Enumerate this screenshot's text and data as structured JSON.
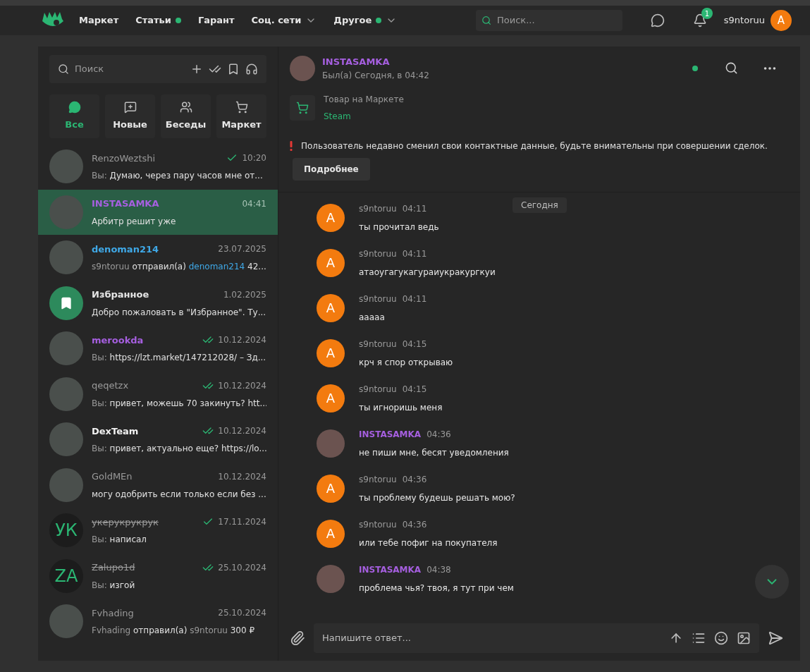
{
  "nav": {
    "items": [
      {
        "label": "Маркет",
        "dot": false,
        "dropdown": false
      },
      {
        "label": "Статьи",
        "dot": true,
        "dropdown": false
      },
      {
        "label": "Гарант",
        "dot": false,
        "dropdown": false
      },
      {
        "label": "Соц. сети",
        "dot": false,
        "dropdown": true
      },
      {
        "label": "Другое",
        "dot": true,
        "dropdown": true
      }
    ],
    "search": {
      "placeholder": "Поиск..."
    },
    "notifications": "1",
    "username": "s9ntoruu",
    "avatar_letter": "A"
  },
  "sidebar": {
    "search": {
      "placeholder": "Поиск"
    },
    "filters": [
      {
        "label": "Все",
        "selected": true,
        "kind": "all"
      },
      {
        "label": "Новые",
        "selected": false,
        "kind": "new"
      },
      {
        "label": "Беседы",
        "selected": false,
        "kind": "groups"
      },
      {
        "label": "Маркет",
        "selected": false,
        "kind": "market"
      }
    ],
    "chats": [
      {
        "name": "RenzoWeztshi",
        "color": "#9a9a9a",
        "bold": false,
        "struck": false,
        "time": "10:20",
        "sent": true,
        "read": false,
        "selected": false,
        "avatar": {
          "kind": "photo"
        },
        "preview": [
          {
            "text": "Вы:",
            "kind": "muted"
          },
          {
            "text": "Думаю, через пару часов мне от...",
            "kind": "normal"
          }
        ]
      },
      {
        "name": "INSTASAMKA",
        "color": "#a65fe0",
        "bold": true,
        "struck": false,
        "time": "04:41",
        "sent": false,
        "selected": true,
        "avatar": {
          "kind": "photo"
        },
        "preview": [
          {
            "text": "Арбитр решит уже",
            "kind": "normal"
          }
        ]
      },
      {
        "name": "denoman214",
        "color": "#3fa9e8",
        "bold": true,
        "struck": false,
        "time": "23.07.2025",
        "sent": false,
        "selected": false,
        "avatar": {
          "kind": "photo"
        },
        "preview": [
          {
            "text": "s9ntoruu",
            "kind": "muted"
          },
          {
            "text": "отправил(а)",
            "kind": "normal"
          },
          {
            "text": "denoman214",
            "kind": "link"
          },
          {
            "text": "42...",
            "kind": "normal"
          }
        ]
      },
      {
        "name": "Избранное",
        "color": "#e6e6e6",
        "bold": true,
        "struck": false,
        "time": "1.02.2025",
        "sent": false,
        "selected": false,
        "avatar": {
          "kind": "bookmark"
        },
        "preview": [
          {
            "text": "Добро пожаловать в \"Избранное\". Ту...",
            "kind": "normal"
          }
        ]
      },
      {
        "name": "merookda",
        "color": "#a65fe0",
        "bold": true,
        "struck": false,
        "time": "10.12.2024",
        "sent": true,
        "read": true,
        "selected": false,
        "avatar": {
          "kind": "photo"
        },
        "preview": [
          {
            "text": "Вы:",
            "kind": "muted"
          },
          {
            "text": "https://lzt.market/147212028/ – Зд...",
            "kind": "normal"
          }
        ]
      },
      {
        "name": "qeqetzx",
        "color": "#9a9a9a",
        "bold": false,
        "struck": false,
        "time": "10.12.2024",
        "sent": true,
        "read": true,
        "selected": false,
        "avatar": {
          "kind": "photo"
        },
        "preview": [
          {
            "text": "Вы:",
            "kind": "muted"
          },
          {
            "text": "привет, можешь 70 закинуть? htt...",
            "kind": "normal"
          }
        ]
      },
      {
        "name": "DexTeam",
        "color": "#f2f2f2",
        "bold": true,
        "struck": false,
        "time": "10.12.2024",
        "sent": true,
        "read": true,
        "selected": false,
        "avatar": {
          "kind": "photo"
        },
        "preview": [
          {
            "text": "Вы:",
            "kind": "muted"
          },
          {
            "text": "привет, актуально еще? https://lo...",
            "kind": "normal"
          }
        ]
      },
      {
        "name": "GoldMEn",
        "color": "#9a9a9a",
        "bold": false,
        "struck": false,
        "time": "10.12.2024",
        "sent": false,
        "selected": false,
        "avatar": {
          "kind": "photo"
        },
        "preview": [
          {
            "text": "могу одобрить если только если без ...",
            "kind": "normal"
          }
        ]
      },
      {
        "name": "укерукрукрук",
        "color": "#9a9a9a",
        "bold": false,
        "struck": true,
        "time": "17.11.2024",
        "sent": true,
        "read": false,
        "selected": false,
        "avatar": {
          "kind": "initials",
          "text": "УК"
        },
        "preview": [
          {
            "text": "Вы:",
            "kind": "muted"
          },
          {
            "text": "написал",
            "kind": "normal"
          }
        ]
      },
      {
        "name": "Zalupo1d",
        "color": "#9a9a9a",
        "bold": false,
        "struck": true,
        "time": "25.10.2024",
        "sent": true,
        "read": true,
        "selected": false,
        "avatar": {
          "kind": "initials",
          "text": "ZA"
        },
        "preview": [
          {
            "text": "Вы:",
            "kind": "muted"
          },
          {
            "text": "изгой",
            "kind": "normal"
          }
        ]
      },
      {
        "name": "Fvhading",
        "color": "#9a9a9a",
        "bold": false,
        "struck": false,
        "time": "25.10.2024",
        "sent": false,
        "selected": false,
        "avatar": {
          "kind": "photo"
        },
        "preview": [
          {
            "text": "Fvhading",
            "kind": "muted"
          },
          {
            "text": "отправил(а)",
            "kind": "normal"
          },
          {
            "text": "s9ntoruu",
            "kind": "muted"
          },
          {
            "text": "300 ₽",
            "kind": "normal"
          }
        ]
      }
    ]
  },
  "chat": {
    "header": {
      "name": "INSTASAMKA",
      "status": "Был(а) Сегодня, в 04:42",
      "online": true
    },
    "product": {
      "label": "Товар на Маркете",
      "title": "Steam"
    },
    "warning": {
      "text": "Пользователь недавно сменил свои контактные данные, будьте внимательны при совершении сделок.",
      "button": "Подробнее"
    },
    "date_separator": "Сегодня",
    "messages": [
      {
        "author": "s9ntoruu",
        "mine": true,
        "avatar_letter": "A",
        "time": "04:11",
        "text": "ты прочитал ведь"
      },
      {
        "author": "s9ntoruu",
        "mine": true,
        "avatar_letter": "A",
        "time": "04:11",
        "text": "атаоугагукагураиукракургкуи"
      },
      {
        "author": "s9ntoruu",
        "mine": true,
        "avatar_letter": "A",
        "time": "04:11",
        "text": "ааааа"
      },
      {
        "author": "s9ntoruu",
        "mine": true,
        "avatar_letter": "A",
        "time": "04:15",
        "text": "крч я спор открываю"
      },
      {
        "author": "s9ntoruu",
        "mine": true,
        "avatar_letter": "A",
        "time": "04:15",
        "text": "ты игноришь меня"
      },
      {
        "author": "INSTASAMKA",
        "mine": false,
        "time": "04:36",
        "text": "не пиши мне, бесят уведомления"
      },
      {
        "author": "s9ntoruu",
        "mine": true,
        "avatar_letter": "A",
        "time": "04:36",
        "text": "ты проблему будешь решать мою?"
      },
      {
        "author": "s9ntoruu",
        "mine": true,
        "avatar_letter": "A",
        "time": "04:36",
        "text": "или тебе пофиг на покупателя"
      },
      {
        "author": "INSTASAMKA",
        "mine": false,
        "time": "04:38",
        "text": "проблема чья? твоя, я тут при чем"
      }
    ],
    "composer": {
      "placeholder": "Напишите ответ..."
    }
  }
}
